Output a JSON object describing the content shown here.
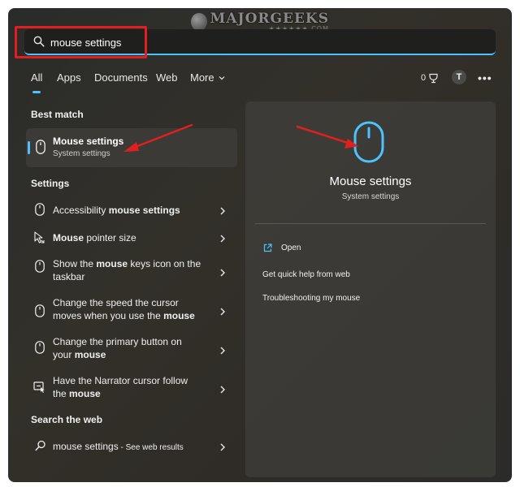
{
  "watermark": {
    "title": "MAJORGEEKS",
    "subtitle": "★★★★★★.COM"
  },
  "search": {
    "value": "mouse settings",
    "placeholder": ""
  },
  "tabs": [
    {
      "label": "All",
      "active": true
    },
    {
      "label": "Apps"
    },
    {
      "label": "Documents"
    },
    {
      "label": "Web"
    },
    {
      "label": "More"
    }
  ],
  "header_right": {
    "points": "0",
    "avatar_initial": "T",
    "more_label": "•••"
  },
  "best_match": {
    "section_label": "Best match",
    "title": "Mouse settings",
    "subtitle": "System settings",
    "icon": "mouse-icon"
  },
  "settings": {
    "section_label": "Settings",
    "items": [
      {
        "pre": "Accessibility ",
        "bold": "mouse settings",
        "post": "",
        "icon": "mouse-icon"
      },
      {
        "pre": "",
        "bold": "Mouse",
        "post": " pointer size",
        "icon": "pointer-size-icon"
      },
      {
        "pre": "Show the ",
        "bold": "mouse",
        "post": " keys icon on the taskbar",
        "icon": "mouse-icon"
      },
      {
        "pre": "Change the speed the cursor moves when you use the ",
        "bold": "mouse",
        "post": "",
        "icon": "mouse-icon"
      },
      {
        "pre": "Change the primary button on your ",
        "bold": "mouse",
        "post": "",
        "icon": "mouse-icon"
      },
      {
        "pre": "Have the Narrator cursor follow the ",
        "bold": "mouse",
        "post": "",
        "icon": "narrator-icon"
      }
    ]
  },
  "web": {
    "section_label": "Search the web",
    "query": "mouse settings",
    "suffix": " - See web results",
    "icon": "search-icon"
  },
  "preview": {
    "title": "Mouse settings",
    "subtitle": "System settings",
    "actions": [
      {
        "label": "Open",
        "icon": "open-external-icon"
      },
      {
        "label": "Get quick help from web"
      },
      {
        "label": "Troubleshooting my mouse"
      }
    ]
  },
  "colors": {
    "accent": "#4cc2ff",
    "annotation": "#e02020",
    "panel_bg": "#2e2d2a"
  }
}
